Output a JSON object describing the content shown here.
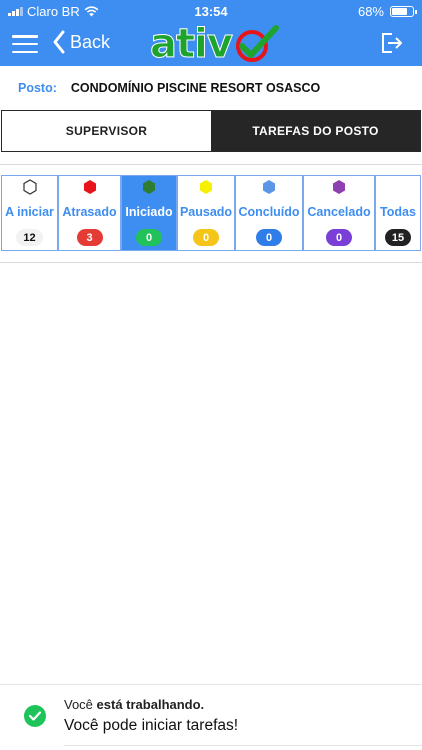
{
  "status_bar": {
    "carrier": "Claro BR",
    "time": "13:54",
    "battery": "68%",
    "battery_level": 0.68
  },
  "navbar": {
    "back_label": "Back",
    "logo_text": "ativ",
    "accent_color": "#3d8ef0",
    "logo_color": "#1ea42e",
    "icons": [
      "menu-icon",
      "chevron-left-icon",
      "checkmark-logo-icon",
      "logout-icon"
    ]
  },
  "posto": {
    "label": "Posto:",
    "value": "CONDOMÍNIO PISCINE RESORT OSASCO"
  },
  "tabs": [
    {
      "label": "SUPERVISOR",
      "active": false
    },
    {
      "label": "TAREFAS DO POSTO",
      "active": true
    }
  ],
  "filters": [
    {
      "label": "A iniciar",
      "count": "12",
      "icon_color": "#ffffff",
      "badge_color": "#f2f2f2",
      "selected": false
    },
    {
      "label": "Atrasado",
      "count": "3",
      "icon_color": "#e8141b",
      "badge_color": "#e53b35",
      "selected": false
    },
    {
      "label": "Iniciado",
      "count": "0",
      "icon_color": "#2e7d32",
      "badge_color": "#21c25a",
      "selected": true
    },
    {
      "label": "Pausado",
      "count": "0",
      "icon_color": "#f7f000",
      "badge_color": "#f5c518",
      "selected": false
    },
    {
      "label": "Concluído",
      "count": "0",
      "icon_color": "#5b95e8",
      "badge_color": "#2f7de8",
      "selected": false
    },
    {
      "label": "Cancelado",
      "count": "0",
      "icon_color": "#8e3fb0",
      "badge_color": "#7a3fd6",
      "selected": false
    },
    {
      "label": "Todas",
      "count": "15",
      "icon_color": "",
      "badge_color": "#222222",
      "selected": false
    }
  ],
  "footer": {
    "line1_prefix": "Você ",
    "line1_bold": "está trabalhando.",
    "line2": "Você pode iniciar tarefas!",
    "status_color": "#1ec45a"
  }
}
